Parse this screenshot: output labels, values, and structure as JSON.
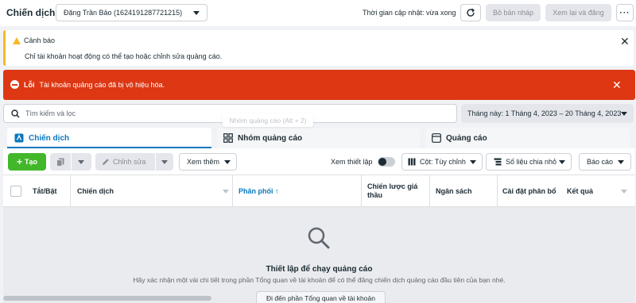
{
  "header": {
    "title": "Chiến dịch",
    "account": "Đặng Trần Bảo (1624191287721215)",
    "update_time": "Thời gian cập nhật: vừa xong",
    "discard_label": "Bỏ bản nháp",
    "review_publish_label": "Xem lại và đăng",
    "more_label": "···"
  },
  "warning": {
    "title": "Cảnh báo",
    "message": "Chỉ tài khoản hoạt động có thể tạo hoặc chỉnh sửa quảng cáo."
  },
  "error": {
    "title": "Lỗi",
    "message": "Tài khoản quảng cáo đã bị vô hiệu hóa."
  },
  "search": {
    "placeholder": "Tìm kiếm và lọc"
  },
  "date_range": "Tháng này: 1 Tháng 4, 2023 – 20 Tháng 4, 2023",
  "tooltip": "Nhóm quảng cáo (Alt + 2)",
  "tabs": [
    {
      "label": "Chiến dịch",
      "active": true
    },
    {
      "label": "Nhóm quảng cáo",
      "active": false
    },
    {
      "label": "Quảng cáo",
      "active": false
    }
  ],
  "toolbar": {
    "create_label": "Tạo",
    "edit_label": "Chỉnh sửa",
    "view_more_label": "Xem thêm",
    "setup_view_label": "Xem thiết lập",
    "columns_label": "Cột: Tùy chỉnh",
    "breakdown_label": "Số liệu chia nhỏ",
    "report_label": "Báo cáo"
  },
  "table": {
    "columns": [
      "Tắt/Bật",
      "Chiến dịch",
      "Phân phối ↑",
      "Chiến lược giá thầu",
      "Ngân sách",
      "Cài đặt phân bổ",
      "Kết quả"
    ]
  },
  "empty_state": {
    "title": "Thiết lập để chạy quảng cáo",
    "description": "Hãy xác nhận một vài chi tiết trong phần Tổng quan về tài khoản để có thể đăng chiến dịch quảng cáo đầu tiên của bạn nhé.",
    "button_label": "Đi đến phần Tổng quan về tài khoản"
  },
  "colors": {
    "accent": "#0a78be",
    "create_green": "#42b72a",
    "error_red": "#dd3714",
    "warning_yellow": "#f7b928"
  }
}
